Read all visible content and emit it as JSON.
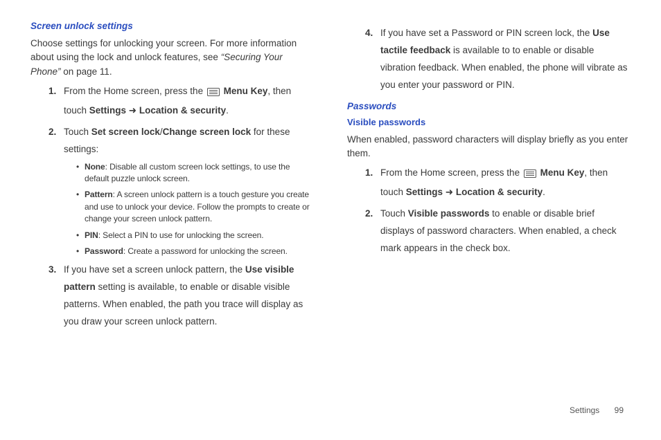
{
  "left": {
    "h1": "Screen unlock settings",
    "intro1": "Choose settings for unlocking your screen. For more information about using the lock and unlock features, see ",
    "intro_ref": "“Securing Your Phone”",
    "intro2": " on page 11.",
    "step1_a": "From the Home screen, press the ",
    "step1_b": "Menu Key",
    "step1_c": ", then touch ",
    "step1_d": "Settings",
    "step1_e": " ➜ ",
    "step1_f": "Location & security",
    "step1_g": ".",
    "step2_a": "Touch ",
    "step2_b": "Set screen lock",
    "step2_c": "/",
    "step2_d": "Change screen lock",
    "step2_e": " for these settings:",
    "bul1_b": "None",
    "bul1_t": ": Disable all custom screen lock settings, to use the default puzzle unlock screen.",
    "bul2_b": "Pattern",
    "bul2_t": ": A screen unlock pattern is a touch gesture you create and use to unlock your device. Follow the prompts to create or change your screen unlock pattern.",
    "bul3_b": "PIN",
    "bul3_t": ": Select a PIN to use for unlocking the screen.",
    "bul4_b": "Password",
    "bul4_t": ": Create a password for unlocking the screen.",
    "step3_a": "If you have set a screen unlock pattern, the ",
    "step3_b": "Use visible pattern",
    "step3_c": " setting is available, to enable or disable visible patterns. When enabled, the path you trace will display as you draw your screen unlock pattern."
  },
  "right": {
    "step4_a": "If you have set a Password or PIN screen lock, the ",
    "step4_b": "Use tactile feedback",
    "step4_c": " is available to to enable or disable vibration feedback. When enabled, the phone will vibrate as you enter your password or PIN.",
    "h_passwords": "Passwords",
    "h_visible": "Visible passwords",
    "intro": "When enabled, password characters will display briefly as you enter them.",
    "step1_a": "From the Home screen, press the ",
    "step1_b": "Menu Key",
    "step1_c": ", then touch ",
    "step1_d": "Settings",
    "step1_e": " ➜ ",
    "step1_f": "Location & security",
    "step1_g": ".",
    "step2_a": "Touch ",
    "step2_b": "Visible passwords",
    "step2_c": " to enable or disable brief displays of password characters. When enabled, a check mark appears in the check box."
  },
  "footer": {
    "section": "Settings",
    "page": "99"
  }
}
